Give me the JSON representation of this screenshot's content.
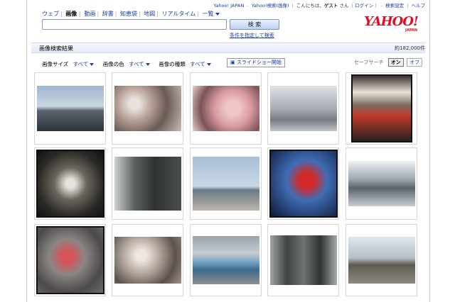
{
  "topbar": {
    "links": [
      "Yahoo! JAPAN",
      "Yahoo!検索(画像)"
    ],
    "greeting_prefix": "こんにちは、",
    "guest": "ゲスト",
    "greeting_suffix": "さん",
    "login": "ログイン",
    "settings": "検索設定",
    "help": "ヘルプ"
  },
  "tabs": [
    "ウェブ",
    "画像",
    "動画",
    "辞書",
    "知恵袋",
    "地図",
    "リアルタイム",
    "一覧"
  ],
  "search": {
    "value": "",
    "button": "検 索",
    "advanced": "条件を指定して検索"
  },
  "logo": {
    "text": "YAHOO!",
    "sub": "JAPAN"
  },
  "results": {
    "title": "画像検索結果",
    "count": "約182,000件"
  },
  "filters": [
    {
      "label": "画像サイズ",
      "value": "すべて"
    },
    {
      "label": "画像の色",
      "value": "すべて"
    },
    {
      "label": "画像の種類",
      "value": "すべて"
    }
  ],
  "slideshow": "スライドショー開始",
  "safesearch": {
    "label": "セーフサーチ",
    "on": "オン",
    "off": "オフ"
  },
  "images": [
    {
      "name": "stadium-photo",
      "bg": "linear-gradient(#9fb6cf 0%,#c9d6e2 45%,#5a6470 55%,#2f3338 100%)"
    },
    {
      "name": "cherry-blossom-branch",
      "bg": "radial-gradient(circle at 30% 40%,#e9e1dc 10%,#b9a49a 30%,#6a5a55 60%,#c8bdb6 100%)"
    },
    {
      "name": "cherry-blossom-pink",
      "bg": "radial-gradient(circle at 60% 50%,#f1c6c9 15%,#d69aa0 40%,#7b5358 70%,#e5cfcf 100%)"
    },
    {
      "name": "campsite-trees",
      "bg": "linear-gradient(#dfe3e8 0%,#a7adb3 50%,#767c82 75%,#c2c5c8 100%)"
    },
    {
      "name": "red-chairs",
      "bg": "linear-gradient(#3a302c 0%,#e9e2d8 25%,#7a6a60 45%,#c23a2a 60%,#2a2220 100%)"
    },
    {
      "name": "cat-photo",
      "bg": "radial-gradient(circle at 50% 50%,#e5e2dd 10%,#6b665f 35%,#2c2a27 70%,#111 100%)"
    },
    {
      "name": "monument-forest",
      "bg": "linear-gradient(90deg,#cfd2cf 0%,#5c625e 30%,#2e332f 60%,#4a4f4b 100%)"
    },
    {
      "name": "beach-sea",
      "bg": "linear-gradient(#a9bfd6 0%,#c8d7e4 55%,#6b7a86 62%,#bcb6ac 100%)"
    },
    {
      "name": "red-flower-sky",
      "bg": "radial-gradient(circle at 55% 45%,#d22a2a 15%,#3f6db5 40%,#1f3460 80%,#0d1a30 100%)"
    },
    {
      "name": "train-station",
      "bg": "linear-gradient(#eef2f6 0%,#9fa7ae 40%,#5d656c 60%,#c7ccd0 100%)"
    },
    {
      "name": "red-flower-water",
      "bg": "radial-gradient(circle at 45% 45%,#d4545a 12%,#8a8684 35%,#4c4a49 70%,#6e6c6a 100%)"
    },
    {
      "name": "white-blossoms",
      "bg": "radial-gradient(circle at 40% 40%,#efe8e2 10%,#b9aca4 35%,#5c514b 70%,#9f938b 100%)"
    },
    {
      "name": "blue-tents",
      "bg": "linear-gradient(#9aa4ab 0%,#c6ccd0 35%,#6fa0c3 55%,#3d6a8c 70%,#8b8f8e 100%)"
    },
    {
      "name": "tall-trees",
      "bg": "linear-gradient(90deg,#9ea3a4 0%,#3f4440 25%,#6d7370 50%,#2f3330 75%,#a6aaa8 100%)"
    },
    {
      "name": "train-platform",
      "bg": "linear-gradient(#dfe6ec 0%,#b7c0c6 45%,#5f5b52 60%,#8e8a82 100%)"
    }
  ]
}
